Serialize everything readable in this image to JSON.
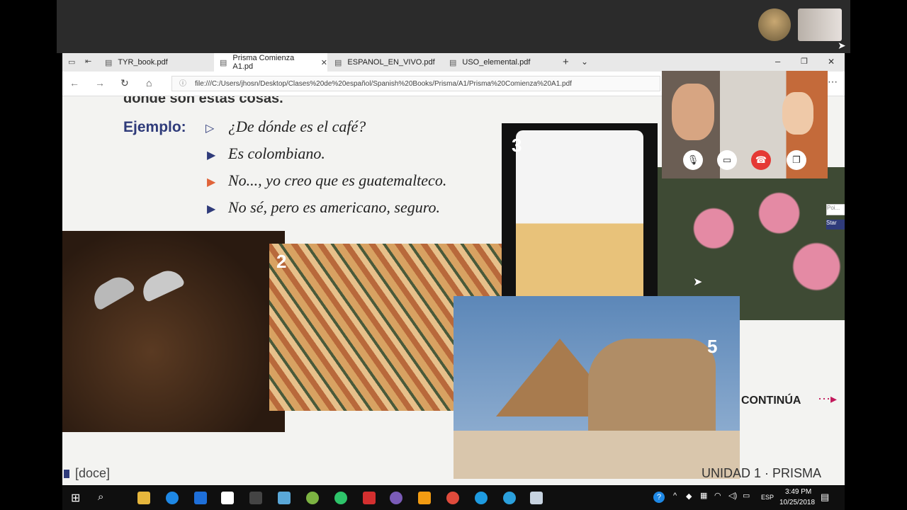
{
  "tabs": [
    {
      "label": "TYR_book.pdf"
    },
    {
      "label": "Prisma Comienza A1.pd",
      "active": true
    },
    {
      "label": "ESPANOL_EN_VIVO.pdf"
    },
    {
      "label": "USO_elemental.pdf"
    }
  ],
  "address": {
    "url": "file:///C:/Users/jhosn/Desktop/Clases%20de%20español/Spanish%20Books/Prisma/A1/Prisma%20Comienza%20A1.pdf"
  },
  "pdf": {
    "heading": "dónde son estas cosas.",
    "ejemplo_label": "Ejemplo:",
    "lines": [
      "¿De dónde es el café?",
      "Es colombiano.",
      "No..., yo creo que es guatemalteco.",
      "No sé, pero es americano, seguro."
    ],
    "image_numbers": [
      "2",
      "3",
      "5"
    ],
    "continua": "CONTINÚA",
    "page_number": "[doce]",
    "footer": "UNIDAD 1 · PRISMA"
  },
  "side_snippets": {
    "input": "Poi...",
    "button": "Star"
  },
  "clock": {
    "time": "3:49 PM",
    "date": "10/25/2018",
    "lang": "ESP"
  },
  "colors": {
    "accent": "#2f3b7a",
    "continua": "#c2185b",
    "end_call": "#e53935"
  }
}
